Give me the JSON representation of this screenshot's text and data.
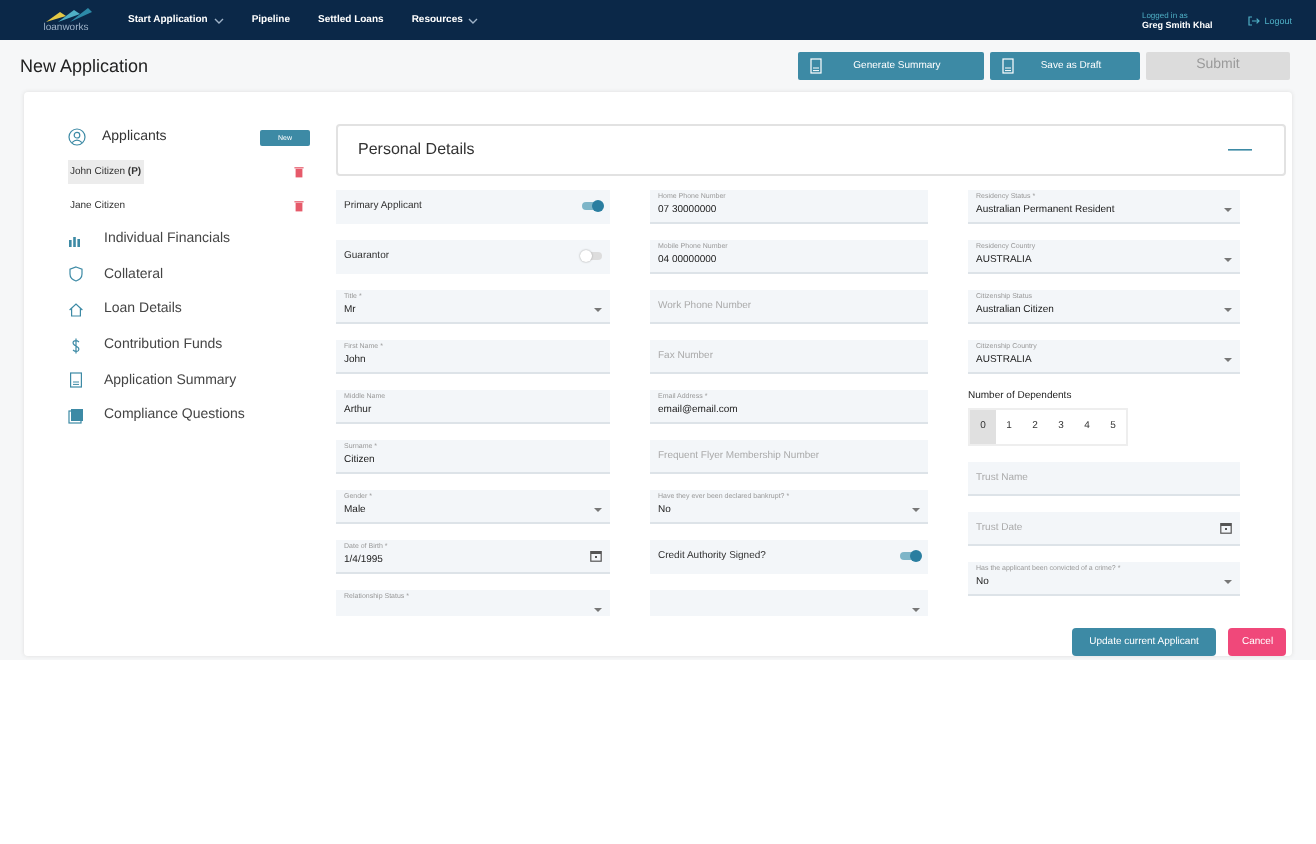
{
  "header": {
    "logo": "loanworks",
    "nav": [
      {
        "label": "Start Application",
        "dropdown": true
      },
      {
        "label": "Pipeline",
        "dropdown": false
      },
      {
        "label": "Settled Loans",
        "dropdown": false
      },
      {
        "label": "Resources",
        "dropdown": true
      }
    ],
    "user_caption": "Logged in as",
    "user_name": "Greg Smith Khal",
    "logout": "Logout"
  },
  "page_title": "New Application",
  "actions": [
    {
      "label": "Generate Summary",
      "disabled": false
    },
    {
      "label": "Save as Draft",
      "disabled": false
    },
    {
      "label": "Submit",
      "disabled": true
    }
  ],
  "sidebar": {
    "applicants_label": "Applicants",
    "new_button": "New",
    "applicants": [
      {
        "name": "John Citizen",
        "suffix": "(P)",
        "selected": true
      },
      {
        "name": "Jane Citizen",
        "selected": false
      }
    ],
    "items": [
      {
        "label": "Individual Financials"
      },
      {
        "label": "Collateral"
      },
      {
        "label": "Loan Details"
      },
      {
        "label": "Contribution Funds"
      },
      {
        "label": "Application Summary"
      },
      {
        "label": "Compliance Questions"
      }
    ]
  },
  "section_title": "Personal Details",
  "columns": [
    [
      {
        "kind": "toggle",
        "label": "Primary Applicant",
        "on": true
      },
      {
        "kind": "toggle",
        "label": "Guarantor",
        "on": false
      },
      {
        "kind": "select",
        "label": "Title *",
        "value": "Mr"
      },
      {
        "kind": "text",
        "label": "First Name *",
        "value": "John"
      },
      {
        "kind": "text",
        "label": "Middle Name",
        "value": "Arthur"
      },
      {
        "kind": "text",
        "label": "Surname *",
        "value": "Citizen"
      },
      {
        "kind": "select",
        "label": "Gender *",
        "value": "Male"
      },
      {
        "kind": "date",
        "label": "Date of Birth *",
        "value": "1/4/1995"
      },
      {
        "kind": "select",
        "label": "Relationship Status *"
      }
    ],
    [
      {
        "kind": "text",
        "label": "Home Phone Number",
        "value": "07 30000000"
      },
      {
        "kind": "text",
        "label": "Mobile Phone Number",
        "value": "04 00000000"
      },
      {
        "kind": "text",
        "placeholder": "Work Phone Number"
      },
      {
        "kind": "text",
        "placeholder": "Fax Number"
      },
      {
        "kind": "text",
        "label": "Email Address *",
        "value": "email@email.com"
      },
      {
        "kind": "text",
        "placeholder": "Frequent Flyer Membership Number"
      },
      {
        "kind": "select",
        "label": "Have they ever been declared bankrupt? *",
        "value": "No"
      },
      {
        "kind": "toggle",
        "label": "Credit Authority Signed?",
        "on": true
      },
      {
        "kind": "select"
      }
    ],
    [
      {
        "kind": "select",
        "label": "Residency Status *",
        "value": "Australian Permanent Resident"
      },
      {
        "kind": "select",
        "label": "Residency Country",
        "value": "AUSTRALIA"
      },
      {
        "kind": "select",
        "label": "Citizenship Status",
        "value": "Australian Citizen"
      },
      {
        "kind": "select",
        "label": "Citizenship Country",
        "value": "AUSTRALIA"
      },
      {
        "kind": "dependents",
        "label": "Number of Dependents",
        "options": [
          {
            "label": "0",
            "selected": true
          },
          {
            "label": "1",
            "selected": false
          },
          {
            "label": "2",
            "selected": false
          },
          {
            "label": "3",
            "selected": false
          },
          {
            "label": "4",
            "selected": false
          },
          {
            "label": "5",
            "selected": false
          }
        ]
      },
      {
        "kind": "text",
        "placeholder": "Trust Name"
      },
      {
        "kind": "date",
        "placeholder": "Trust Date"
      },
      {
        "kind": "select",
        "label": "Has the applicant been convicted of a crime? *",
        "value": "No"
      }
    ]
  ],
  "footer_buttons": [
    {
      "label": "Update current Applicant",
      "kind": "primary"
    },
    {
      "label": "Cancel",
      "kind": "danger"
    }
  ]
}
